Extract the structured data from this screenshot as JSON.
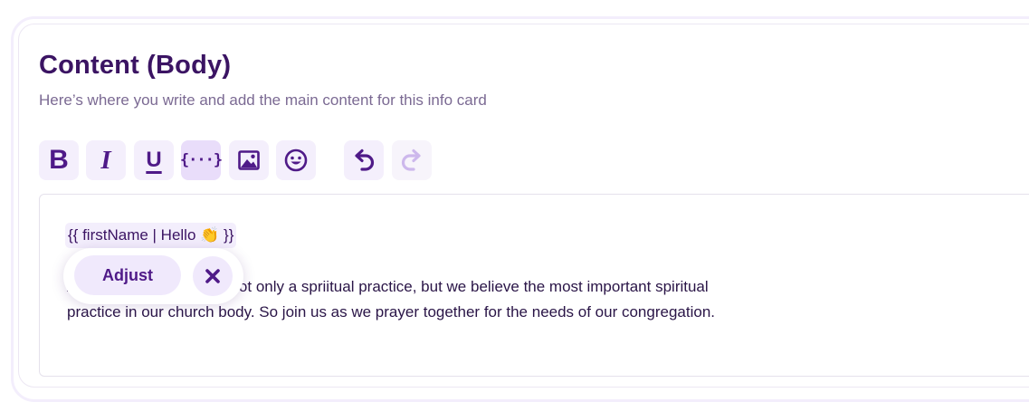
{
  "section": {
    "title": "Content (Body)",
    "subtitle": "Here’s where you write and add the main content for this info card"
  },
  "toolbar": {
    "bold_label": "B",
    "italic_label": "I",
    "underline_label": "U",
    "variable_label": "{···}",
    "buttons": [
      {
        "name": "bold",
        "icon": "bold-icon"
      },
      {
        "name": "italic",
        "icon": "italic-icon"
      },
      {
        "name": "underline",
        "icon": "underline-icon"
      },
      {
        "name": "variable",
        "icon": "variable-braces-icon",
        "active": true
      },
      {
        "name": "image",
        "icon": "image-icon"
      },
      {
        "name": "emoji",
        "icon": "smiley-icon"
      },
      {
        "name": "undo",
        "icon": "undo-icon"
      },
      {
        "name": "redo",
        "icon": "redo-icon",
        "disabled": true
      }
    ]
  },
  "editor": {
    "variable_chip": "{{ firstName | Hello 👏 }}",
    "paragraph": "At our church, prayer is not only a spriitual practice, but we believe the most important spiritual practice in our church body. So join us as we prayer together for the needs of our congregation."
  },
  "popup": {
    "adjust_label": "Adjust",
    "close_icon": "close-icon"
  },
  "colors": {
    "accent": "#4f1a88",
    "title": "#3b1463",
    "button_bg": "#f4effc",
    "button_active_bg": "#e9ddfa",
    "disabled_icon": "#cdb8ec"
  }
}
